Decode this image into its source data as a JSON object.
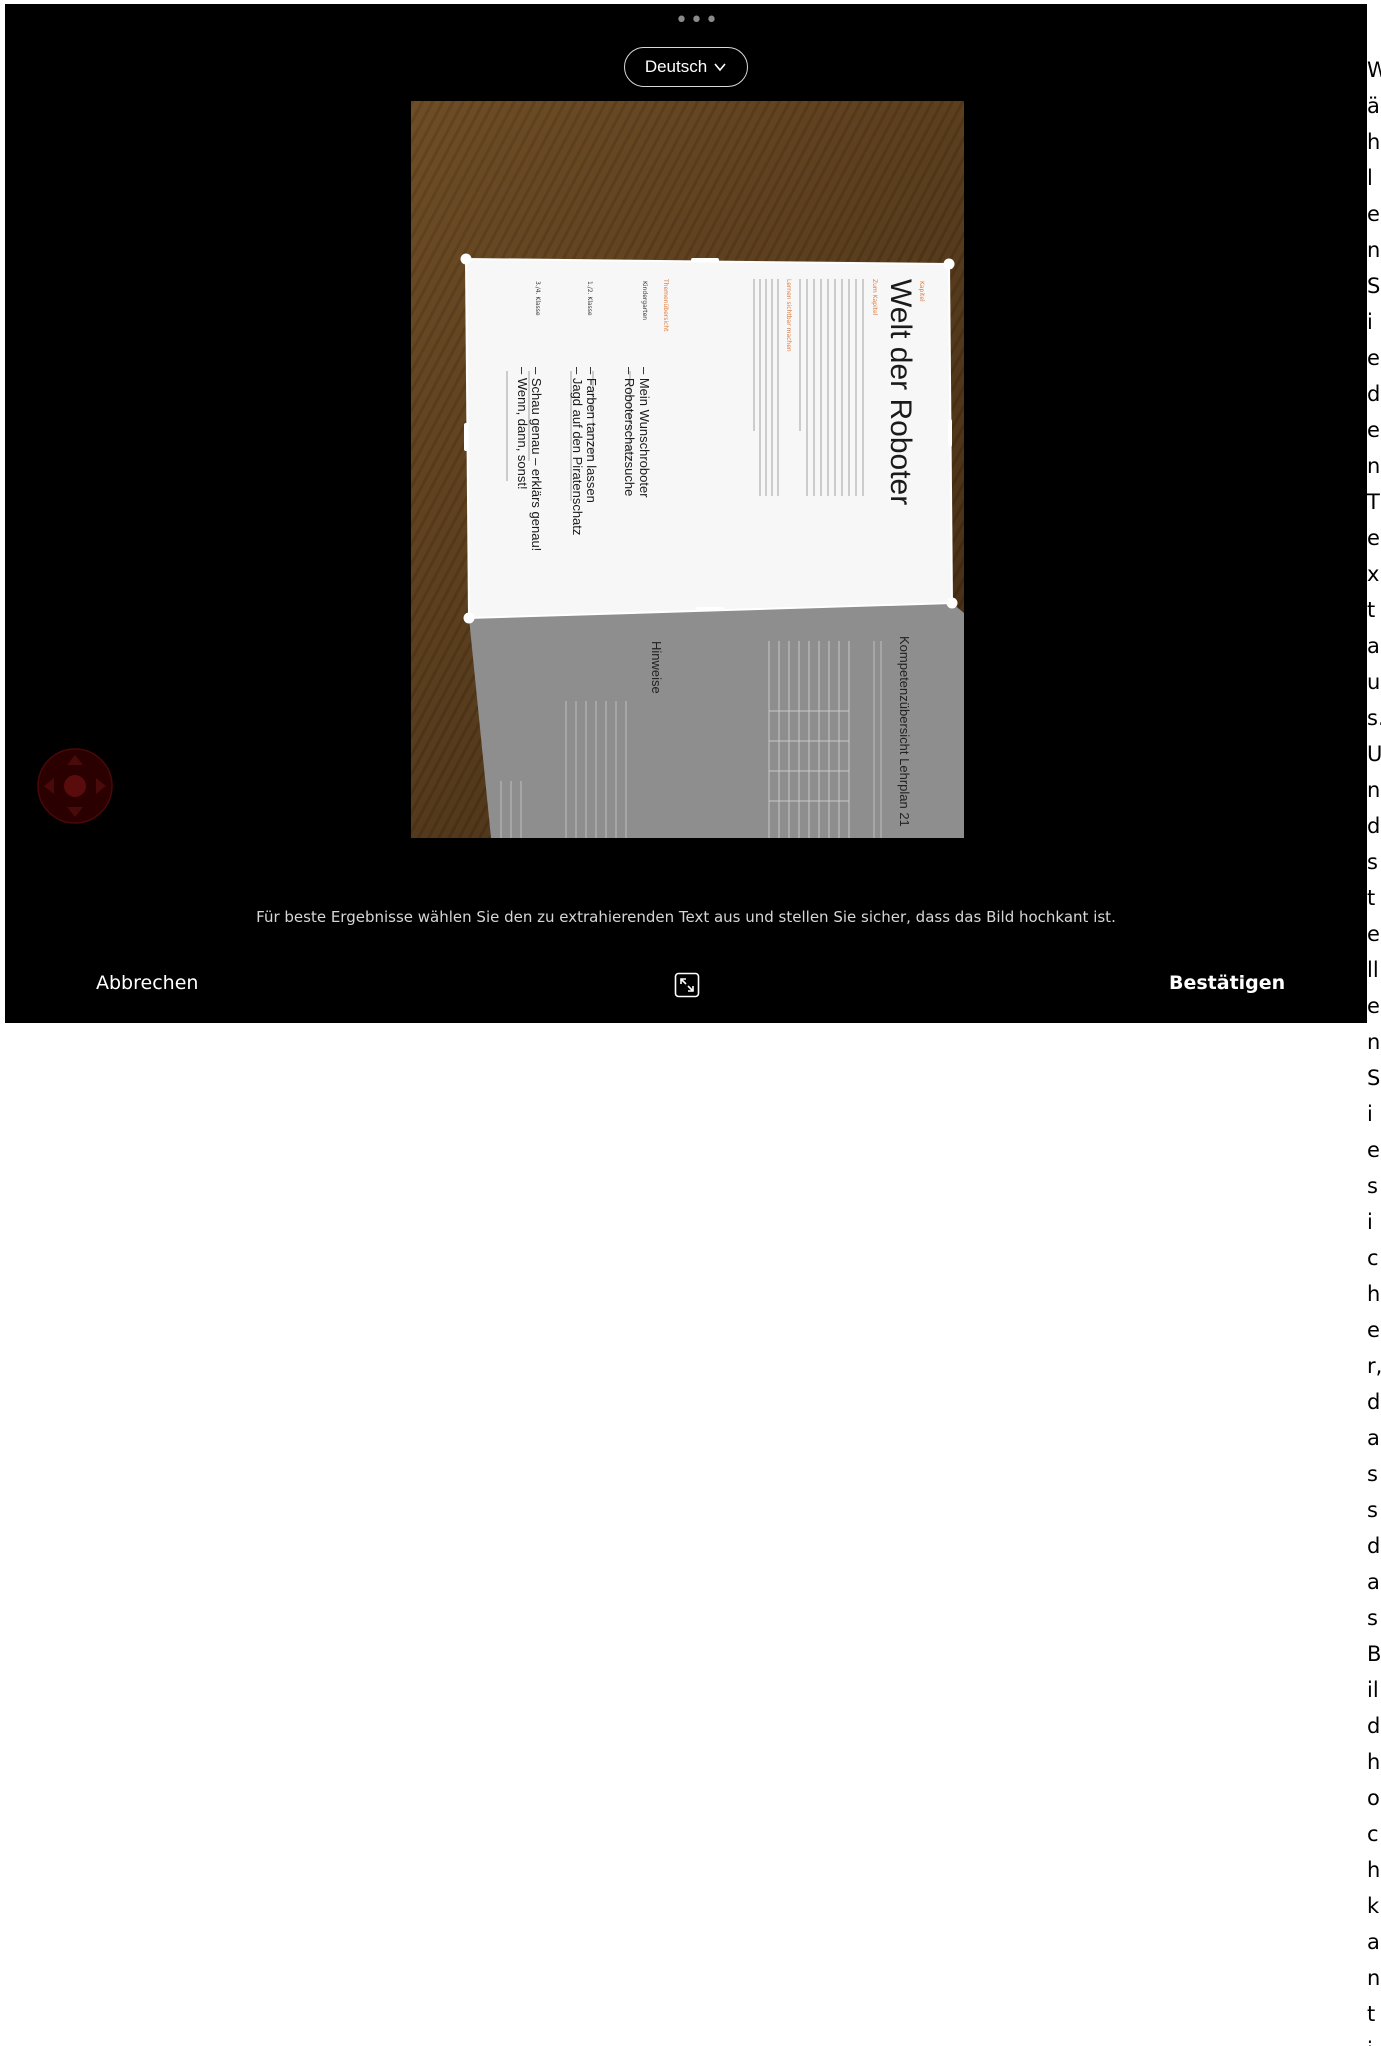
{
  "toolbar": {
    "more_icon": "ellipsis-icon",
    "language": "Deutsch"
  },
  "document": {
    "chapter_label": "Kapitel",
    "chapter_sub": "Zum Kapitel",
    "title": "Welt der Roboter",
    "section1": "Lernen sichtbar machen",
    "section2": "Themenübersicht",
    "grade_kg": "Kindergarten",
    "grade_12": "1./2. Klasse",
    "grade_34": "3./4. Klasse",
    "topic1": "– Mein Wunschroboter",
    "topic2": "– Roboterschatzsuche",
    "topic3": "– Farben tanzen lassen",
    "topic4": "– Jagd auf den Piratenschatz",
    "topic5": "– Schau genau – erklärs genau!",
    "topic6": "– Wenn, dann, sonst!",
    "next_title": "Kompetenzübersicht Lehrplan 21",
    "next_section": "Hinweise"
  },
  "hint": "Für beste Ergebnisse wählen Sie den zu extrahierenden Text aus und stellen Sie sicher, dass das Bild hochkant ist.",
  "footer": {
    "cancel": "Abbrechen",
    "confirm": "Bestätigen",
    "expand_icon": "expand-icon"
  },
  "side_text": "Wählen Sie den Text aus. Und stellen Sie sicher, dass das Bild hochkant ist."
}
